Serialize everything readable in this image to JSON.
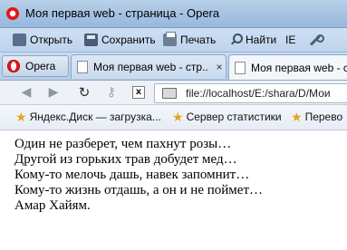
{
  "window": {
    "title": "Моя первая web - страница - Opera"
  },
  "menubar": {
    "open": "Открыть",
    "save": "Сохранить",
    "print": "Печать",
    "find": "Найти",
    "ie": "IE"
  },
  "tabstrip": {
    "menu_button": "Opera",
    "tabs": [
      {
        "label": "Моя первая web - стр...",
        "active": false
      },
      {
        "label": "Моя первая web - ст",
        "active": true
      }
    ],
    "close_glyph": "×"
  },
  "addressbar": {
    "stop_glyph": "x",
    "url": "file://localhost/E:/shara/D/Мои"
  },
  "bookmarks": [
    {
      "label": "Яндекс.Диск — загрузка..."
    },
    {
      "label": "Сервер статистики"
    },
    {
      "label": "Перево"
    }
  ],
  "content": {
    "lines": [
      "Один не разберет, чем пахнут розы…",
      "Другой из горьких трав добудет мед…",
      "Кому-то мелочь дашь, навек запомнит…",
      "Кому-то жизнь отдашь, а он и не поймет…",
      "Амар Хайям."
    ]
  },
  "colors": {
    "titlebar": "#a8c4e3",
    "bookmark_star": "#e0a61c",
    "opera_red": "#e4161b"
  }
}
